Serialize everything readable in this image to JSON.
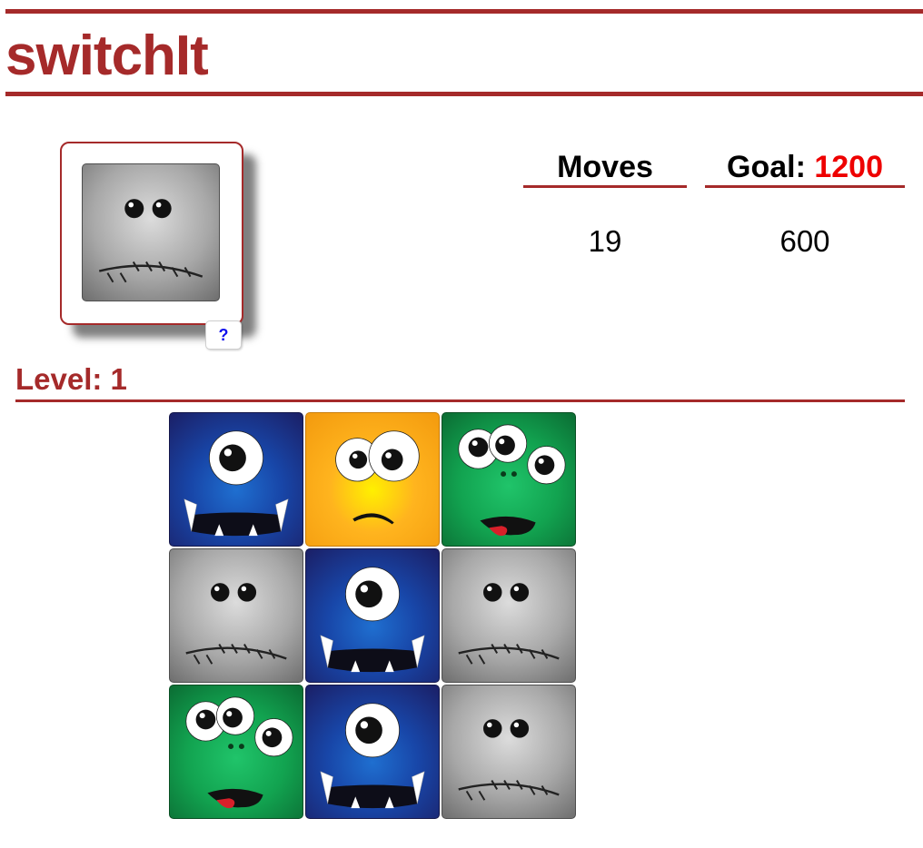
{
  "app": {
    "title": "switchIt"
  },
  "preview": {
    "tile": "gray",
    "help_label": "?"
  },
  "stats": {
    "moves_label": "Moves",
    "goal_label": "Goal:",
    "goal_value": "1200",
    "moves_value": "19",
    "score_value": "600"
  },
  "level": {
    "label": "Level: 1"
  },
  "board": {
    "rows": [
      [
        "blue",
        "orange",
        "green"
      ],
      [
        "gray",
        "blue",
        "gray"
      ],
      [
        "green",
        "blue",
        "gray"
      ]
    ]
  },
  "colors": {
    "accent": "#a52a2a",
    "goal": "#ee0000",
    "help": "#1010ee"
  }
}
